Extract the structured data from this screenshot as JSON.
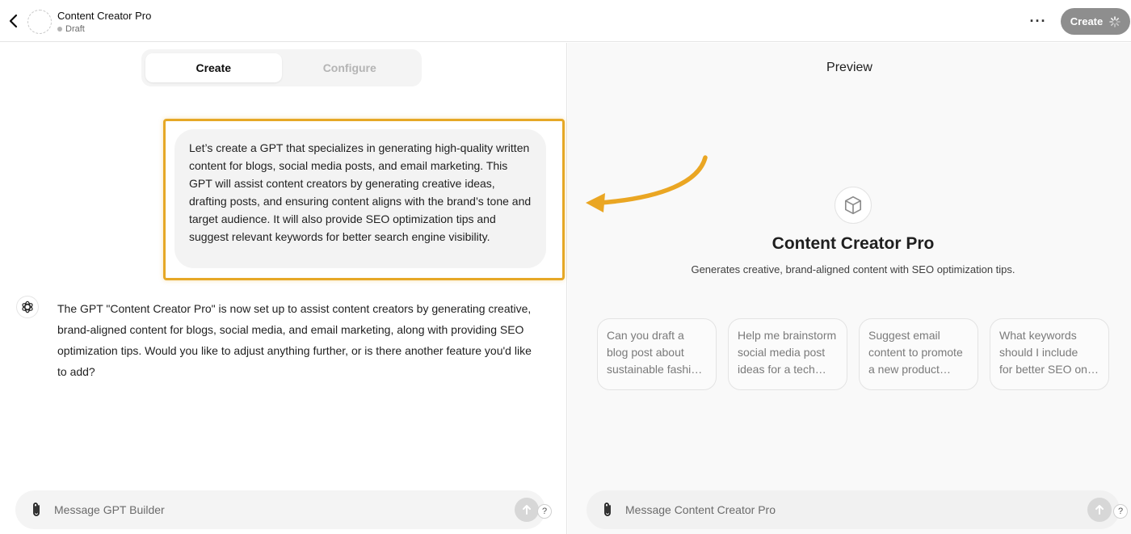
{
  "header": {
    "title": "Content Creator Pro",
    "status": "Draft",
    "more_label": "···",
    "create_label": "Create"
  },
  "tabs": [
    {
      "label": "Create",
      "active": true
    },
    {
      "label": "Configure",
      "active": false
    }
  ],
  "conversation": {
    "user_message": "Let’s create a GPT that specializes in generating high-quality written content for blogs, social media posts, and email marketing. This GPT will assist content creators by generating creative ideas, drafting posts, and ensuring content aligns with the brand’s tone and target audience. It will also provide SEO optimization tips and suggest relevant keywords for better search engine visibility.",
    "bot_message": "The GPT \"Content Creator Pro\" is now set up to assist content creators by generating creative, brand-aligned content for blogs, social media, and email marketing, along with providing SEO optimization tips. Would you like to adjust anything further, or is there another feature you'd like to add?"
  },
  "left_composer": {
    "placeholder": "Message GPT Builder",
    "help_label": "?"
  },
  "preview": {
    "heading": "Preview",
    "gpt_name": "Content Creator Pro",
    "gpt_description": "Generates creative, brand-aligned content with SEO optimization tips.",
    "starters": [
      {
        "lines": [
          "Can you draft a",
          "blog post about",
          "sustainable fashion?"
        ]
      },
      {
        "lines": [
          "Help me brainstorm",
          "social media post",
          "ideas for a tech…"
        ]
      },
      {
        "lines": [
          "Suggest email",
          "content to promote",
          "a new product…"
        ]
      },
      {
        "lines": [
          "What keywords",
          "should I include",
          "for better SEO on …"
        ]
      }
    ],
    "composer_placeholder": "Message Content Creator Pro",
    "help_label": "?"
  },
  "colors": {
    "highlight": "#e6a826",
    "arrow": "#eaa623",
    "create_button": "#8e8e8e"
  },
  "icons": {
    "back": "chevron-left-icon",
    "more": "ellipsis-icon",
    "spinner": "loading-spinner-icon",
    "bot": "openai-logo-icon",
    "attach": "paperclip-icon",
    "send": "arrow-up-icon",
    "gpt_logo": "cube-icon"
  }
}
